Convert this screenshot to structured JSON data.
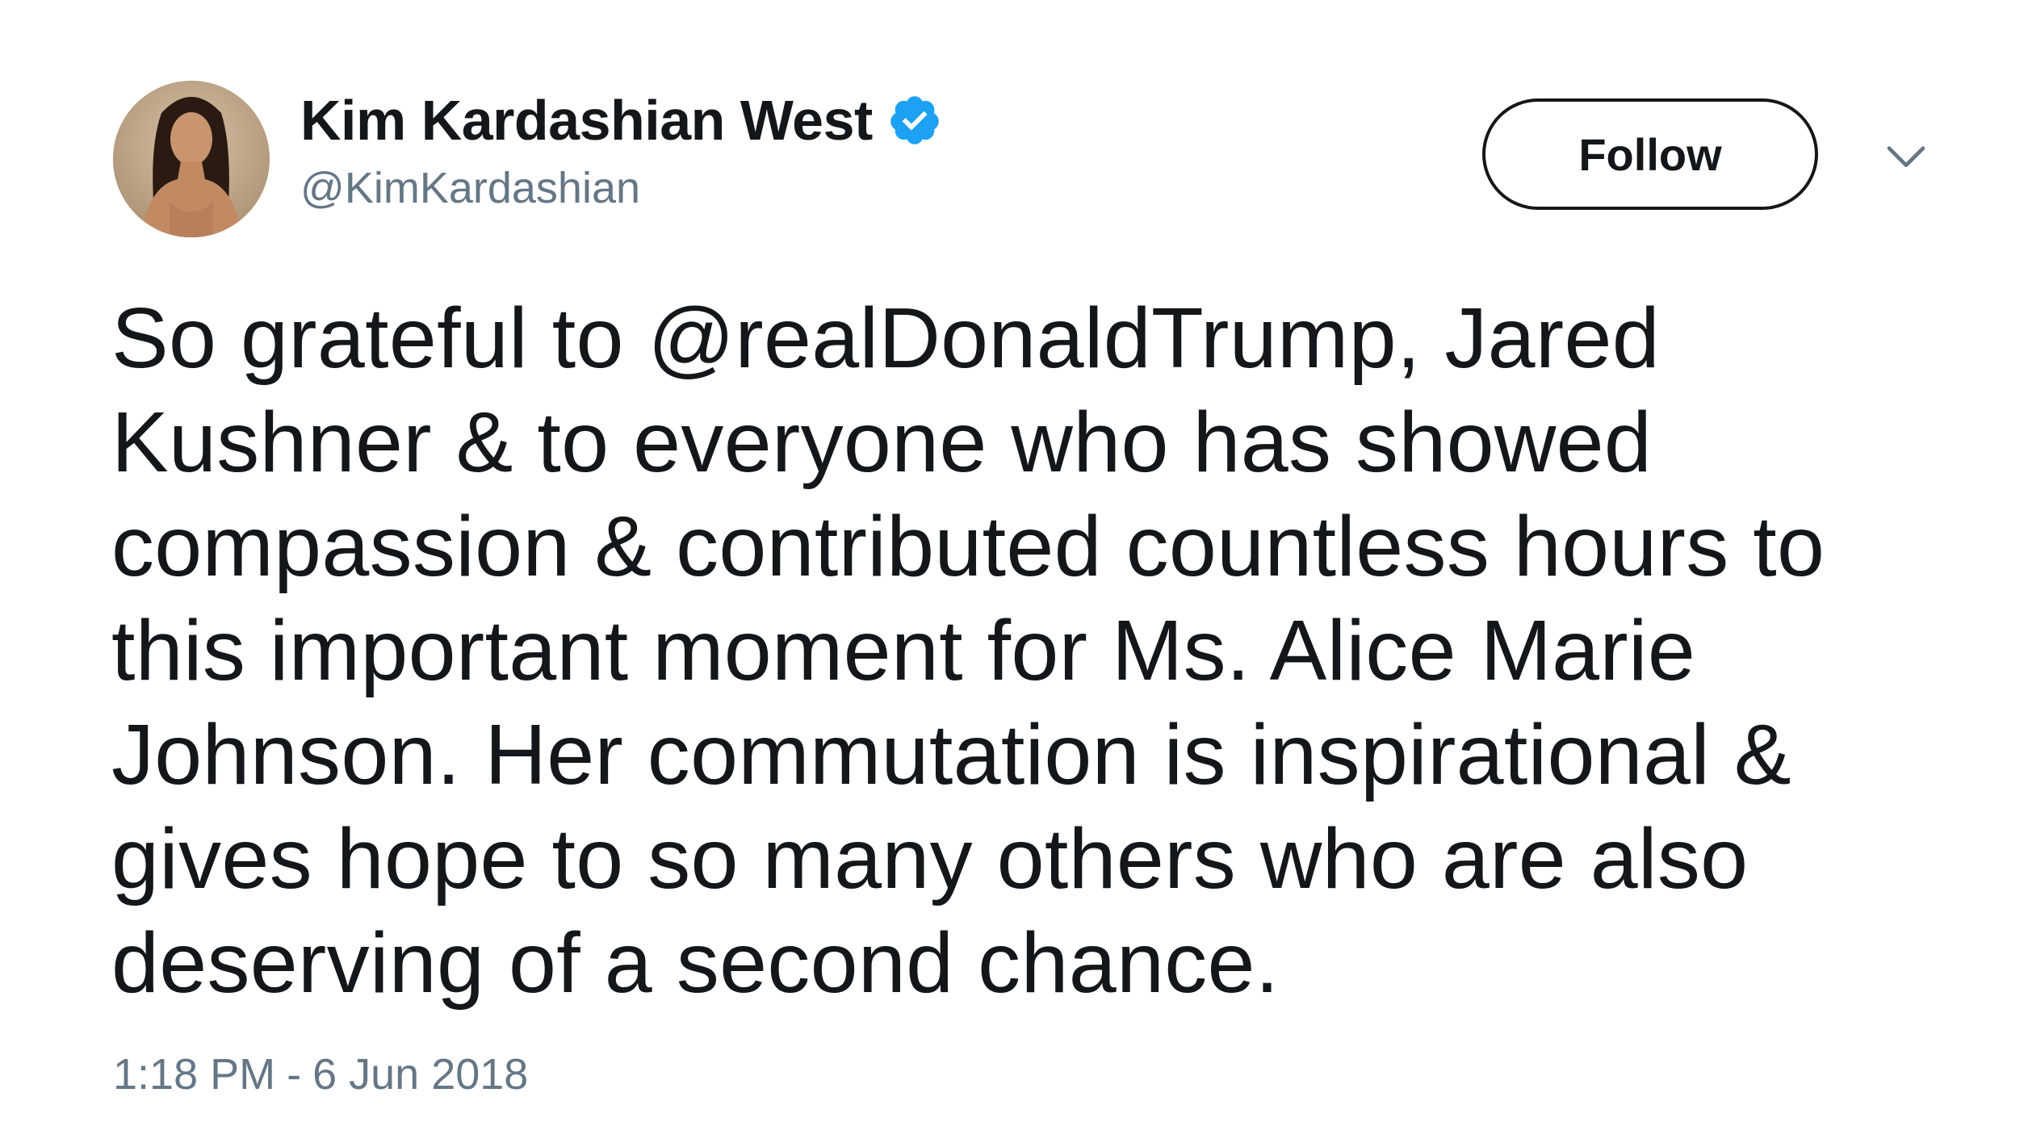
{
  "author": {
    "display_name": "Kim Kardashian West",
    "handle": "@KimKardashian",
    "verified": true,
    "avatar_icon": "profile-photo"
  },
  "actions": {
    "follow_label": "Follow",
    "more_icon": "chevron-down-icon"
  },
  "tweet": {
    "lines": [
      "So grateful to @realDonaldTrump, Jared",
      "Kushner & to everyone who has showed",
      "compassion & contributed countless hours to",
      "this important moment for Ms. Alice Marie",
      "Johnson. Her commutation is inspirational &",
      "gives hope to so many others who are also",
      "deserving of a second chance."
    ]
  },
  "meta": {
    "time": "1:18 PM",
    "separator": "-",
    "date": "6 Jun 2018"
  },
  "colors": {
    "text_primary": "#14171a",
    "text_secondary": "#657786",
    "verified_blue": "#1da1f2",
    "background": "#ffffff"
  }
}
